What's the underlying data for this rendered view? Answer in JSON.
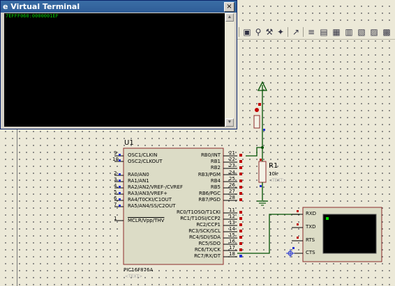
{
  "virtual_terminal": {
    "title": "e Virtual Terminal",
    "close_symbol": "×",
    "output_text": "7EFFF060:0000001EF"
  },
  "toolbar": {
    "icons": [
      "zoom-icon",
      "search-icon",
      "wrench-icon",
      "tools-icon",
      "wand-icon",
      "binoculars-icon",
      "netlist-icon",
      "report-icon",
      "library-icon",
      "text-icon"
    ]
  },
  "microcontroller": {
    "designator": "U1",
    "part_name": "PIC16F876A",
    "text_tag": "<TEXT>",
    "left_pins": [
      {
        "num": "9",
        "name": "OSC1/CLKIN"
      },
      {
        "num": "10",
        "name": "OSC2/CLKOUT"
      },
      {
        "num": "2",
        "name": "RA0/AN0"
      },
      {
        "num": "3",
        "name": "RA1/AN1"
      },
      {
        "num": "4",
        "name": "RA2/AN2/VREF-/CVREF"
      },
      {
        "num": "5",
        "name": "RA3/AN3/VREF+"
      },
      {
        "num": "6",
        "name": "RA4/T0CKI/C1OUT"
      },
      {
        "num": "7",
        "name": "RA5/AN4/SS/C2OUT"
      },
      {
        "num": "1",
        "name": "MCLR/Vpp/THV"
      }
    ],
    "right_pins_top": [
      {
        "num": "21",
        "name": "RB0/INT"
      },
      {
        "num": "22",
        "name": "RB1"
      },
      {
        "num": "23",
        "name": "RB2"
      },
      {
        "num": "24",
        "name": "RB3/PGM"
      },
      {
        "num": "25",
        "name": "RB4"
      },
      {
        "num": "26",
        "name": "RB5"
      },
      {
        "num": "27",
        "name": "RB6/PGC"
      },
      {
        "num": "28",
        "name": "RB7/PGD"
      }
    ],
    "right_pins_bottom": [
      {
        "num": "11",
        "name": "RC0/T1OSO/T1CKI"
      },
      {
        "num": "12",
        "name": "RC1/T1OSI/CCP2"
      },
      {
        "num": "13",
        "name": "RC2/CCP1"
      },
      {
        "num": "14",
        "name": "RC3/SCK/SCL"
      },
      {
        "num": "15",
        "name": "RC4/SDI/SDA"
      },
      {
        "num": "16",
        "name": "RC5/SDO"
      },
      {
        "num": "17",
        "name": "RC6/TX/CK"
      },
      {
        "num": "18",
        "name": "RC7/RX/DT"
      }
    ]
  },
  "resistor": {
    "designator": "R1",
    "value": "10k",
    "text_tag": "<TEXT>"
  },
  "terminal_symbol": {
    "pins": [
      "RXD",
      "TXD",
      "RTS",
      "CTS"
    ]
  },
  "colors": {
    "wire": "#005000",
    "pin_red": "#c00000",
    "pin_blue": "#2030d0",
    "chip_fill": "#dcdcc6",
    "chip_border": "#8b2a2a"
  }
}
